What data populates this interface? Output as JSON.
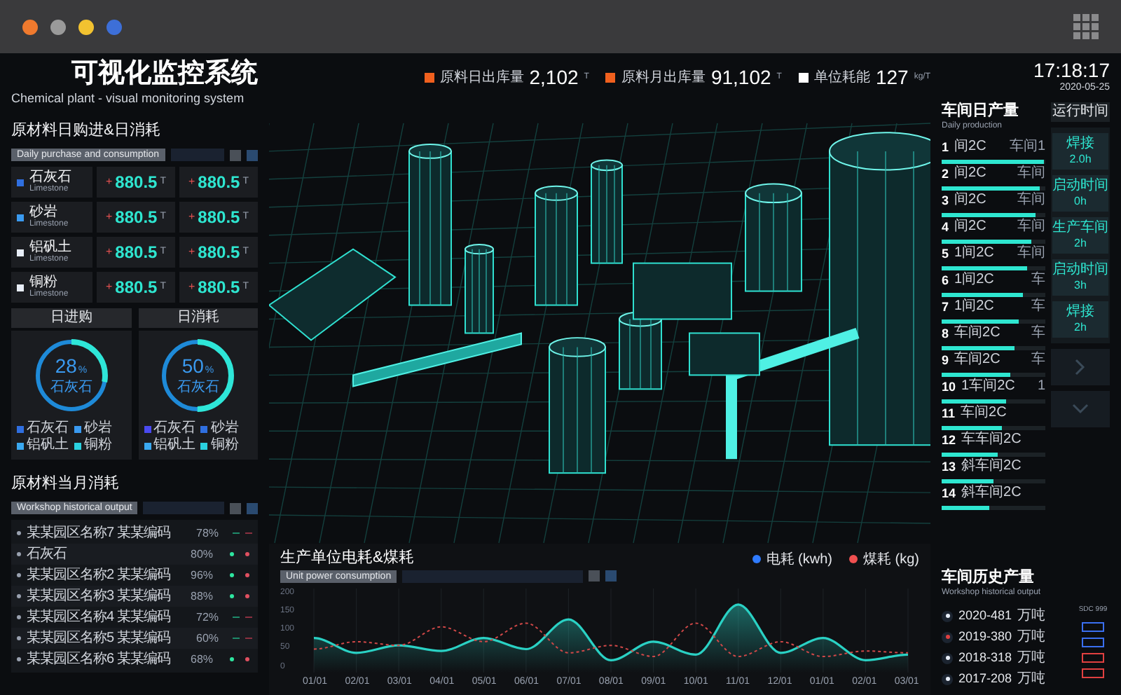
{
  "browser": {
    "dots": [
      {
        "color": "#f07a2e"
      },
      {
        "color": "#9a9a9a"
      },
      {
        "color": "#f2c230"
      },
      {
        "color": "#3d6fd8"
      }
    ]
  },
  "header": {
    "title": "可视化监控系统",
    "subtitle": "Chemical plant - visual monitoring system",
    "time": "17:18:17",
    "date": "2020-05-25",
    "stats": [
      {
        "label": "原料日出库量",
        "value": "2,102",
        "unit": "T",
        "color": "#f0601e"
      },
      {
        "label": "原料月出库量",
        "value": "91,102",
        "unit": "T",
        "color": "#f0601e"
      },
      {
        "label": "单位耗能",
        "value": "127",
        "unit": "kg/T",
        "color": "#ffffff"
      }
    ]
  },
  "purchase": {
    "title": "原材料日购进&日消耗",
    "subtitle": "Daily purchase and consumption",
    "materials": [
      {
        "name": "石灰石",
        "name_en": "Limestone",
        "color": "#2f6fe0",
        "purchase": {
          "sign": "+",
          "value": "880.5",
          "unit": "T"
        },
        "consumption": {
          "sign": "+",
          "value": "880.5",
          "unit": "T"
        }
      },
      {
        "name": "砂岩",
        "name_en": "Limestone",
        "color": "#3a9af0",
        "purchase": {
          "sign": "+",
          "value": "880.5",
          "unit": "T"
        },
        "consumption": {
          "sign": "+",
          "value": "880.5",
          "unit": "T"
        }
      },
      {
        "name": "铝矾土",
        "name_en": "Limestone",
        "color": "#e8eef8",
        "purchase": {
          "sign": "+",
          "value": "880.5",
          "unit": "T"
        },
        "consumption": {
          "sign": "+",
          "value": "880.5",
          "unit": "T"
        }
      },
      {
        "name": "铜粉",
        "name_en": "Limestone",
        "color": "#e8eef8",
        "purchase": {
          "sign": "+",
          "value": "880.5",
          "unit": "T"
        },
        "consumption": {
          "sign": "+",
          "value": "880.5",
          "unit": "T"
        }
      }
    ]
  },
  "donuts": [
    {
      "title": "日进购",
      "percent": "28",
      "unit": "%",
      "label": "石灰石",
      "level": 0.28,
      "legend": [
        {
          "name": "石灰石",
          "color": "#2f6fe0"
        },
        {
          "name": "砂岩",
          "color": "#3a9af0"
        },
        {
          "name": "铝矾土",
          "color": "#3aa8f0"
        },
        {
          "name": "铜粉",
          "color": "#2ad1e0"
        }
      ]
    },
    {
      "title": "日消耗",
      "percent": "50",
      "unit": "%",
      "label": "石灰石",
      "level": 0.5,
      "legend": [
        {
          "name": "石灰石",
          "color": "#4a4af0"
        },
        {
          "name": "砂岩",
          "color": "#2f6fe0"
        },
        {
          "name": "铝矾土",
          "color": "#3aa8f0"
        },
        {
          "name": "铜粉",
          "color": "#2ad1e0"
        }
      ]
    }
  ],
  "monthly": {
    "title": "原材料当月消耗",
    "subtitle": "Workshop historical output",
    "rows": [
      {
        "name": "某某园区名称7 某某编码",
        "percent": "78%",
        "active": false
      },
      {
        "name": "石灰石",
        "percent": "80%",
        "active": true
      },
      {
        "name": "某某园区名称2 某某编码",
        "percent": "96%",
        "active": true
      },
      {
        "name": "某某园区名称3 某某编码",
        "percent": "88%",
        "active": true
      },
      {
        "name": "某某园区名称4 某某编码",
        "percent": "72%",
        "active": false
      },
      {
        "name": "某某园区名称5 某某编码",
        "percent": "60%",
        "active": false
      },
      {
        "name": "某某园区名称6 某某编码",
        "percent": "68%",
        "active": true
      }
    ]
  },
  "chart": {
    "title": "生产单位电耗&煤耗",
    "subtitle": "Unit power consumption",
    "legend": [
      {
        "color": "#2f7bff"
      },
      {
        "color": "#f05050"
      }
    ],
    "chart_data": {
      "type": "line",
      "grid": true,
      "categories": [
        "01/01",
        "02/01",
        "03/01",
        "04/01",
        "05/01",
        "06/01",
        "07/01",
        "08/01",
        "09/01",
        "10/01",
        "11/01",
        "12/01",
        "01/01",
        "02/01",
        "03/01"
      ],
      "ylim": [
        0,
        200
      ],
      "yticks": [
        0,
        50,
        100,
        150,
        200
      ],
      "series": [
        {
          "name": "电耗 (kwh)",
          "type": "area",
          "color": "#2ad1c4",
          "values": [
            80,
            40,
            60,
            45,
            80,
            50,
            130,
            20,
            70,
            35,
            170,
            40,
            80,
            20,
            35
          ]
        },
        {
          "name": "煤耗 (kg)",
          "type": "line",
          "color": "#d04848",
          "line_style": "dashed",
          "values": [
            50,
            70,
            60,
            110,
            70,
            120,
            40,
            60,
            30,
            120,
            30,
            70,
            30,
            45,
            40
          ]
        }
      ]
    }
  },
  "production": {
    "title": "车间日产量",
    "subtitle": "Daily production",
    "rows": [
      {
        "rank": "1",
        "name": "间2C",
        "workshop": "车间1",
        "level": 0.98
      },
      {
        "rank": "2",
        "name": "间2C",
        "workshop": "车间",
        "level": 0.94
      },
      {
        "rank": "3",
        "name": "间2C",
        "workshop": "车间",
        "level": 0.9
      },
      {
        "rank": "4",
        "name": "间2C",
        "workshop": "车间",
        "level": 0.86
      },
      {
        "rank": "5",
        "name": "1间2C",
        "workshop": "车间",
        "level": 0.82
      },
      {
        "rank": "6",
        "name": "1间2C",
        "workshop": "车",
        "level": 0.78
      },
      {
        "rank": "7",
        "name": "1间2C",
        "workshop": "车",
        "level": 0.74
      },
      {
        "rank": "8",
        "name": "车间2C",
        "workshop": "车",
        "level": 0.7
      },
      {
        "rank": "9",
        "name": "车间2C",
        "workshop": "车",
        "level": 0.66
      },
      {
        "rank": "10",
        "name": "1车间2C",
        "workshop": "1",
        "level": 0.62
      },
      {
        "rank": "11",
        "name": "车间2C",
        "level": 0.58
      },
      {
        "rank": "12",
        "name": "车车间2C",
        "level": 0.54
      },
      {
        "rank": "13",
        "name": "斜车间2C",
        "level": 0.5
      },
      {
        "rank": "14",
        "name": "斜车间2C",
        "level": 0.46
      }
    ]
  },
  "runtime": {
    "title": "运行时间",
    "cards": [
      {
        "name": "焊接",
        "value": "2.0h"
      },
      {
        "name": "启动时间",
        "value": "0h"
      },
      {
        "name": "生产车间",
        "value": "2h"
      },
      {
        "name": "启动时间",
        "value": "3h"
      },
      {
        "name": "焊接",
        "value": "2h"
      }
    ]
  },
  "history": {
    "title": "车间历史产量",
    "subtitle": "Workshop historical output",
    "scale_label": "SDC 999",
    "rows": [
      {
        "year_value": "2020-481",
        "unit": "万吨",
        "color": "#e8eef8"
      },
      {
        "year_value": "2019-380",
        "unit": "万吨",
        "color": "#e04040"
      },
      {
        "year_value": "2018-318",
        "unit": "万吨",
        "color": "#e8eef8"
      },
      {
        "year_value": "2017-208",
        "unit": "万吨",
        "color": "#e8eef8"
      }
    ],
    "tags": [
      {
        "color": "#3a6ff0"
      },
      {
        "color": "#3a6ff0"
      },
      {
        "color": "#e04040"
      },
      {
        "color": "#e04040"
      }
    ]
  }
}
